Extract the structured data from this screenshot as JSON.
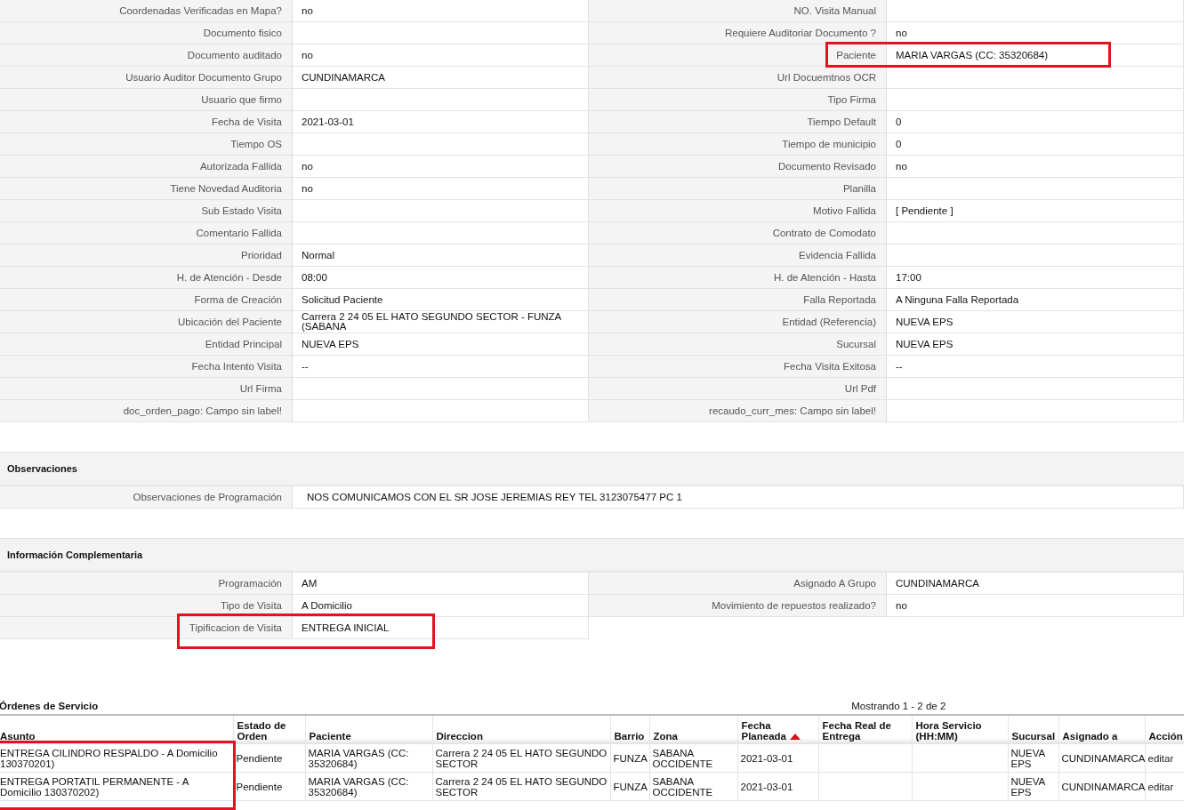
{
  "detail_rows": [
    {
      "left": {
        "label": "Coordenadas Verificadas en Mapa?",
        "value": "no",
        "highlighted": false
      },
      "right": {
        "label": "NO. Visita Manual",
        "highlighted": false
      }
    },
    {
      "left": {
        "label": "Documento fisico",
        "highlighted": false
      },
      "right": {
        "label": "Requiere Auditoriar Documento ?",
        "value": "no",
        "highlighted": false
      }
    },
    {
      "left": {
        "label": "Documento auditado",
        "value": "no",
        "highlighted": false
      },
      "right": {
        "label": "Paciente",
        "value": "MARIA VARGAS (CC: 35320684)",
        "highlighted": true
      }
    },
    {
      "left": {
        "label": "Usuario Auditor Documento Grupo",
        "value": "CUNDINAMARCA",
        "highlighted": false
      },
      "right": {
        "label": "Url Docuemtnos OCR",
        "highlighted": false
      }
    },
    {
      "left": {
        "label": "Usuario que firmo",
        "highlighted": false
      },
      "right": {
        "label": "Tipo Firma",
        "highlighted": false
      }
    },
    {
      "left": {
        "label": "Fecha de Visita",
        "value": "2021-03-01",
        "highlighted": false
      },
      "right": {
        "label": "Tiempo Default",
        "value": "0",
        "highlighted": false
      }
    },
    {
      "left": {
        "label": "Tiempo OS",
        "highlighted": false
      },
      "right": {
        "label": "Tiempo de municipio",
        "value": "0",
        "highlighted": false
      }
    },
    {
      "left": {
        "label": "Autorizada Fallida",
        "value": "no",
        "highlighted": false
      },
      "right": {
        "label": "Documento Revisado",
        "value": "no",
        "highlighted": false
      }
    },
    {
      "left": {
        "label": "Tiene Novedad Auditoria",
        "value": "no",
        "highlighted": false
      },
      "right": {
        "label": "Planilla",
        "highlighted": false
      }
    },
    {
      "left": {
        "label": "Sub Estado Visita",
        "highlighted": false
      },
      "right": {
        "label": "Motivo Fallida",
        "value": "[ Pendiente ]",
        "highlighted": false
      }
    },
    {
      "left": {
        "label": "Comentario Fallida",
        "highlighted": false
      },
      "right": {
        "label": "Contrato de Comodato",
        "highlighted": false
      }
    },
    {
      "left": {
        "label": "Prioridad",
        "value": "Normal",
        "highlighted": false
      },
      "right": {
        "label": "Evidencia Fallida",
        "highlighted": false
      }
    },
    {
      "left": {
        "label": "H. de Atención - Desde",
        "value": "08:00",
        "highlighted": false
      },
      "right": {
        "label": "H. de Atención - Hasta",
        "value": "17:00",
        "highlighted": false
      }
    },
    {
      "left": {
        "label": "Forma de Creación",
        "value": "Solicitud Paciente",
        "highlighted": false
      },
      "right": {
        "label": "Falla Reportada",
        "value": "A Ninguna Falla Reportada",
        "highlighted": false
      }
    },
    {
      "left": {
        "label": "Ubicación del Paciente",
        "value": "Carrera 2 24 05 EL HATO SEGUNDO SECTOR - FUNZA (SABANA",
        "highlighted": false
      },
      "right": {
        "label": "Entidad (Referencia)",
        "value": "NUEVA EPS",
        "highlighted": false
      }
    },
    {
      "left": {
        "label": "Entidad Principal",
        "value": "NUEVA EPS",
        "highlighted": false
      },
      "right": {
        "label": "Sucursal",
        "value": "NUEVA EPS",
        "highlighted": false
      }
    },
    {
      "left": {
        "label": "Fecha Intento Visita",
        "value": "--",
        "highlighted": false
      },
      "right": {
        "label": "Fecha Visita Exitosa",
        "value": "--",
        "highlighted": false
      }
    },
    {
      "left": {
        "label": "Url Firma",
        "highlighted": false
      },
      "right": {
        "label": "Url Pdf",
        "highlighted": false
      }
    },
    {
      "left": {
        "label": "doc_orden_pago: Campo sin label!",
        "highlighted": false
      },
      "right": {
        "label": "recaudo_curr_mes: Campo sin label!",
        "highlighted": false
      }
    }
  ],
  "observaciones": {
    "title": "Observaciones",
    "label": "Observaciones de Programación",
    "value": "NOS COMUNICAMOS CON EL SR JOSE JEREMIAS REY TEL 3123075477 PC 1"
  },
  "informacion_complementaria": {
    "title": "Información Complementaria",
    "rows": [
      {
        "left": {
          "label": "Programación",
          "value": "AM",
          "highlighted": false
        },
        "right": {
          "label": "Asignado A Grupo",
          "value": "CUNDINAMARCA",
          "highlighted": false
        }
      },
      {
        "left": {
          "label": "Tipo de Visita",
          "value": "A Domicilio",
          "highlighted": false
        },
        "right": {
          "label": "Movimiento de repuestos realizado?",
          "value": "no",
          "highlighted": false
        }
      },
      {
        "left": {
          "label": "Tipificacion de Visita",
          "value": "ENTREGA INICIAL",
          "highlighted": true
        }
      }
    ]
  },
  "ordenes": {
    "title": "Órdenes de Servicio",
    "pager": "Mostrando 1 - 2 de 2",
    "first_column_highlighted": true,
    "columns": [
      {
        "label": "Asunto",
        "sorted": false
      },
      {
        "label": "Estado de Orden",
        "sorted": false
      },
      {
        "label": "Paciente",
        "sorted": false
      },
      {
        "label": "Direccion",
        "sorted": false
      },
      {
        "label": "Barrio",
        "sorted": false
      },
      {
        "label": "Zona",
        "sorted": false
      },
      {
        "label": "Fecha Planeada",
        "sorted": true
      },
      {
        "label": "Fecha Real de Entrega",
        "sorted": false
      },
      {
        "label": "Hora Servicio (HH:MM)",
        "sorted": false
      },
      {
        "label": "Sucursal",
        "sorted": false
      },
      {
        "label": "Asignado a",
        "sorted": false
      },
      {
        "label": "Acción",
        "sorted": false
      }
    ],
    "rows": [
      {
        "cells": [
          "ENTREGA CILINDRO RESPALDO - A Domicilio 130370201)",
          "Pendiente",
          "MARIA VARGAS (CC: 35320684)",
          "Carrera 2 24 05 EL HATO SEGUNDO SECTOR",
          "FUNZA",
          "SABANA OCCIDENTE",
          "2021-03-01",
          null,
          null,
          "NUEVA EPS",
          "CUNDINAMARCA"
        ],
        "action": "editar"
      },
      {
        "cells": [
          "ENTREGA PORTATIL PERMANENTE - A Domicilio 130370202)",
          "Pendiente",
          "MARIA VARGAS (CC: 35320684)",
          "Carrera 2 24 05 EL HATO SEGUNDO SECTOR",
          "FUNZA",
          "SABANA OCCIDENTE",
          "2021-03-01",
          null,
          null,
          "NUEVA EPS",
          "CUNDINAMARCA"
        ],
        "action": "editar"
      }
    ]
  }
}
